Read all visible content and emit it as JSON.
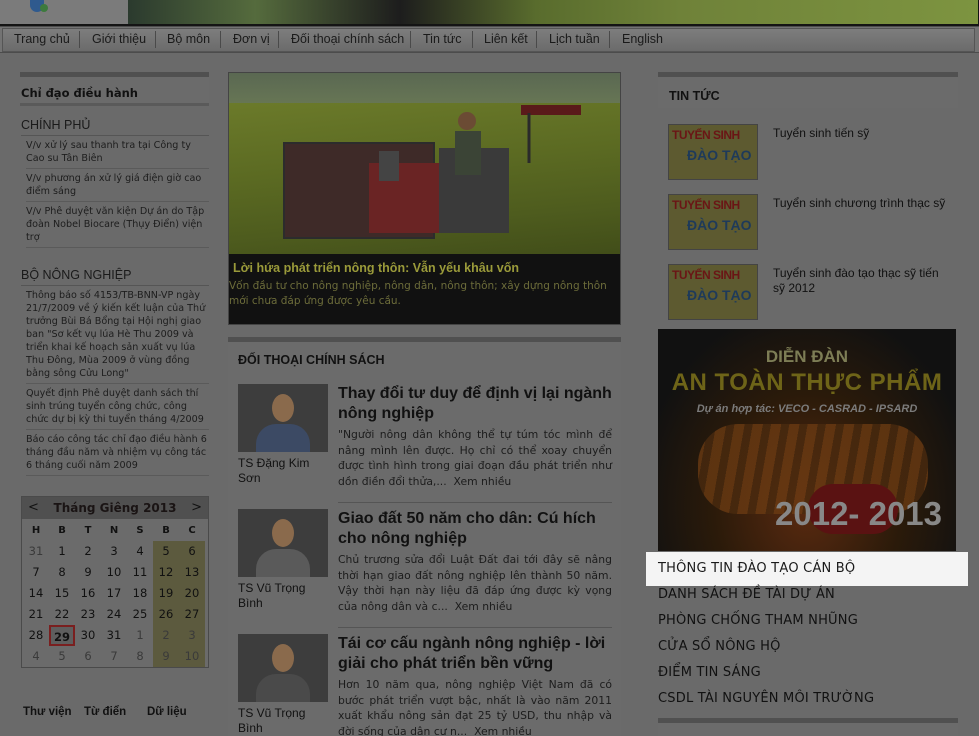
{
  "nav": {
    "items": [
      "Trang chủ",
      "Giới thiệu",
      "Bộ môn",
      "Đơn vị",
      "Đối thoại chính sách",
      "Tin tức",
      "Liên kết",
      "Lịch tuần",
      "English"
    ]
  },
  "left": {
    "section_title": "Chỉ đạo điều hành",
    "gov_title": "CHÍNH PHỦ",
    "gov_links": [
      "V/v xử lý sau thanh tra tại Công ty Cao su Tân Biên",
      "V/v phương án xử lý giá điện giờ cao điểm sáng",
      "V/v Phê duyệt văn kiện Dự án do Tập đoàn Nobel Biocare (Thụy Điển) viện trợ"
    ],
    "ministry_title": "BỘ NÔNG NGHIỆP",
    "ministry_links": [
      "Thông báo số 4153/TB-BNN-VP ngày 21/7/2009 về ý kiến kết luận của Thứ trưởng Bùi Bá Bổng tại Hội nghị giao ban \"Sơ kết vụ lúa Hè Thu 2009 và triển khai kế hoạch sản xuất vụ lúa Thu Đông, Mùa 2009 ở vùng đồng bằng sông Cửu Long\"",
      "Quyết định Phê duyệt danh sách thí sinh trúng tuyển công chức, công chức dự bị kỳ thi tuyển tháng 4/2009",
      "Báo cáo công tác chỉ đạo điều hành 6 tháng đầu năm và nhiệm vụ công tác 6 tháng cuối năm 2009"
    ]
  },
  "calendar": {
    "prev": "<",
    "next": ">",
    "title": "Tháng Giêng 2013",
    "dow": [
      "H",
      "B",
      "T",
      "N",
      "S",
      "B",
      "C"
    ],
    "weeks": [
      [
        "31",
        "1",
        "2",
        "3",
        "4",
        "5",
        "6"
      ],
      [
        "7",
        "8",
        "9",
        "10",
        "11",
        "12",
        "13"
      ],
      [
        "14",
        "15",
        "16",
        "17",
        "18",
        "19",
        "20"
      ],
      [
        "21",
        "22",
        "23",
        "24",
        "25",
        "26",
        "27"
      ],
      [
        "28",
        "29",
        "30",
        "31",
        "1",
        "2",
        "3"
      ],
      [
        "4",
        "5",
        "6",
        "7",
        "8",
        "9",
        "10"
      ]
    ],
    "today": "29"
  },
  "tools": [
    "Thư viện",
    "Từ điển",
    "Dữ liệu"
  ],
  "hero": {
    "title": "Lời hứa phát triển nông thôn: Vẫn yếu khâu vốn",
    "text": "Vốn đầu tư cho nông nghiệp, nông dân, nông thôn; xây dựng nông thôn mới chưa đáp ứng được yêu cầu."
  },
  "dialog": {
    "title": "ĐỐI THOẠI CHÍNH SÁCH",
    "more_label": "Xem nhiều",
    "articles": [
      {
        "title": "Thay đổi tư duy để định vị lại ngành nông nghiệp",
        "summary": "\"Người nông dân không thể tự túm tóc mình để nâng mình lên được. Họ chỉ có thể xoay chuyển được tình hình trong giai đoạn đầu phát triển như dồn điền đổi thửa,...",
        "author": "TS Đặng Kim Sơn"
      },
      {
        "title": "Giao đất 50 năm cho dân: Cú hích cho nông nghiệp",
        "summary": "Chủ trương sửa đổi Luật Đất đai tới đây sẽ nâng thời hạn giao đất nông nghiệp lên thành 50 năm. Vậy thời hạn này liệu đã đáp ứng được kỳ vọng của nông dân và c...",
        "author": "TS Vũ Trọng Bình"
      },
      {
        "title": "Tái cơ cấu ngành nông nghiệp - lời giải cho phát triển bền vững",
        "summary": "Hơn 10 năm qua, nông nghiệp Việt Nam đã có bước phát triển vượt bậc, nhất là vào năm 2011 xuất khẩu nông sản đạt 25 tỷ USD, thu nhập và đời sống của dân cư n...",
        "author": "TS Vũ Trọng Bình"
      }
    ]
  },
  "news": {
    "title": "TIN TỨC",
    "img_line1": "TUYỂN SINH",
    "img_line2": "ĐÀO TẠO",
    "items": [
      "Tuyển sinh tiến sỹ",
      "Tuyển sinh chương trình thạc sỹ",
      "Tuyển sinh đào tạo thạc sỹ tiến sỹ 2012"
    ]
  },
  "forum": {
    "line1": "DIỄN ĐÀN",
    "line2": "AN TOÀN THỰC PHẨM",
    "line3": "Dự án hợp tác: VECO - CASRAD - IPSARD",
    "line4": "2012- 2013"
  },
  "right_links": [
    "THÔNG TIN ĐÀO TẠO CÁN BỘ",
    "DANH SÁCH ĐỀ TÀI DỰ ÁN",
    "PHÒNG CHỐNG THAM NHŨNG",
    "CỬA SỔ NÔNG HỘ",
    "ĐIỂM TIN SÁNG",
    "CSDL TÀI NGUYÊN MÔI TRƯỜNG"
  ]
}
